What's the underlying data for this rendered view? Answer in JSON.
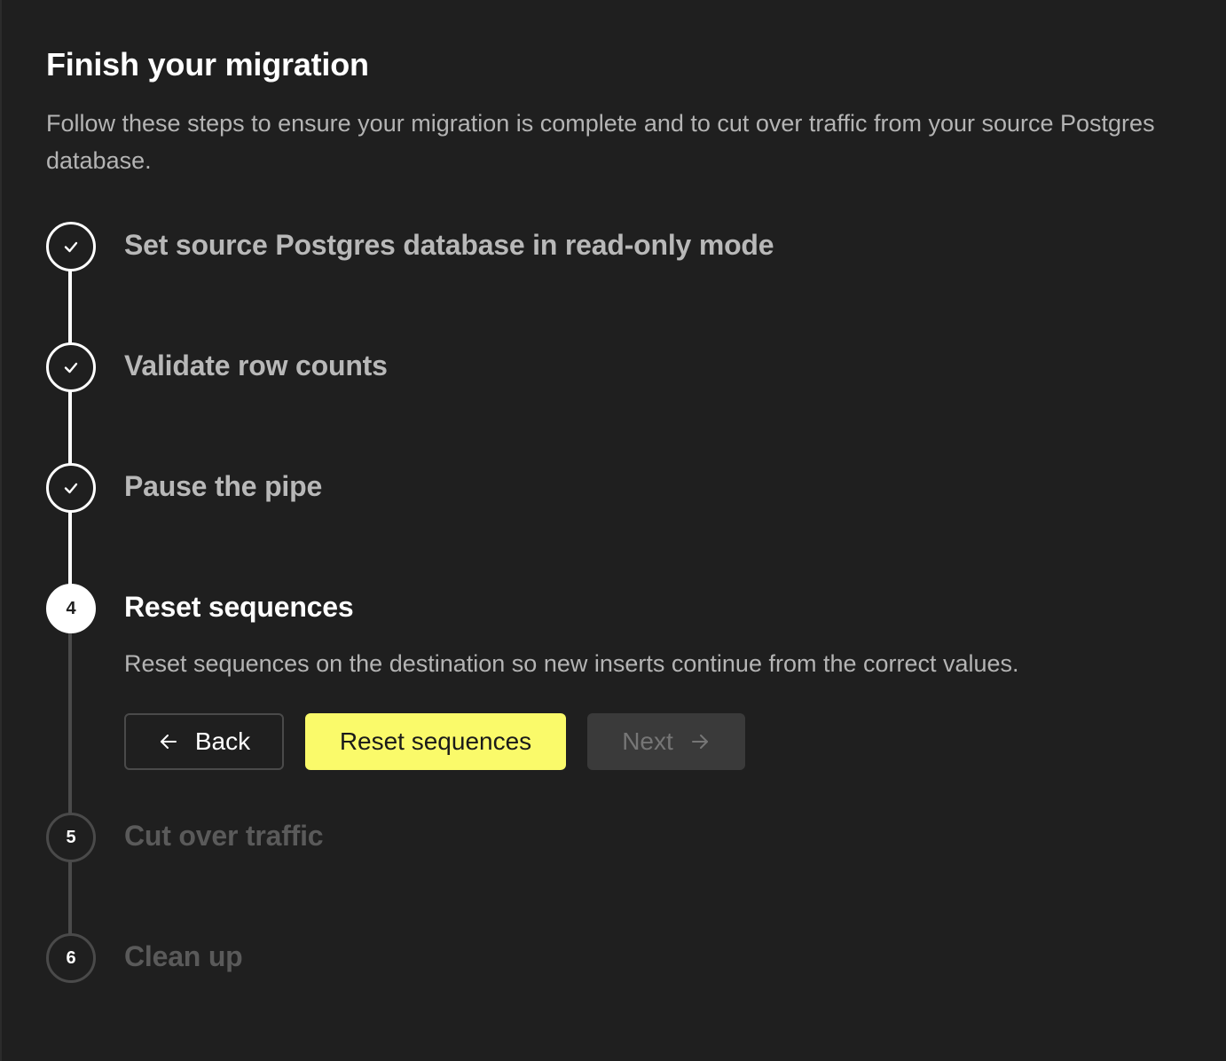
{
  "header": {
    "title": "Finish your migration",
    "subtitle": "Follow these steps to ensure your migration is complete and to cut over traffic from your source Postgres database."
  },
  "steps": [
    {
      "number": "1",
      "label": "Set source Postgres database in read-only mode",
      "status": "done"
    },
    {
      "number": "2",
      "label": "Validate row counts",
      "status": "done"
    },
    {
      "number": "3",
      "label": "Pause the pipe",
      "status": "done"
    },
    {
      "number": "4",
      "label": "Reset sequences",
      "status": "active"
    },
    {
      "number": "5",
      "label": "Cut over traffic",
      "status": "todo"
    },
    {
      "number": "6",
      "label": "Clean up",
      "status": "todo"
    }
  ],
  "active_step": {
    "description": "Reset sequences on the destination so new inserts continue from the correct values.",
    "back_label": "Back",
    "primary_label": "Reset sequences",
    "next_label": "Next"
  },
  "colors": {
    "background": "#1f1f1f",
    "accent": "#fafa6a",
    "done": "#ffffff",
    "pending": "#4a4a4a"
  },
  "icons": {
    "done_step": "check-icon",
    "back": "arrow-left-icon",
    "next": "arrow-right-icon"
  }
}
